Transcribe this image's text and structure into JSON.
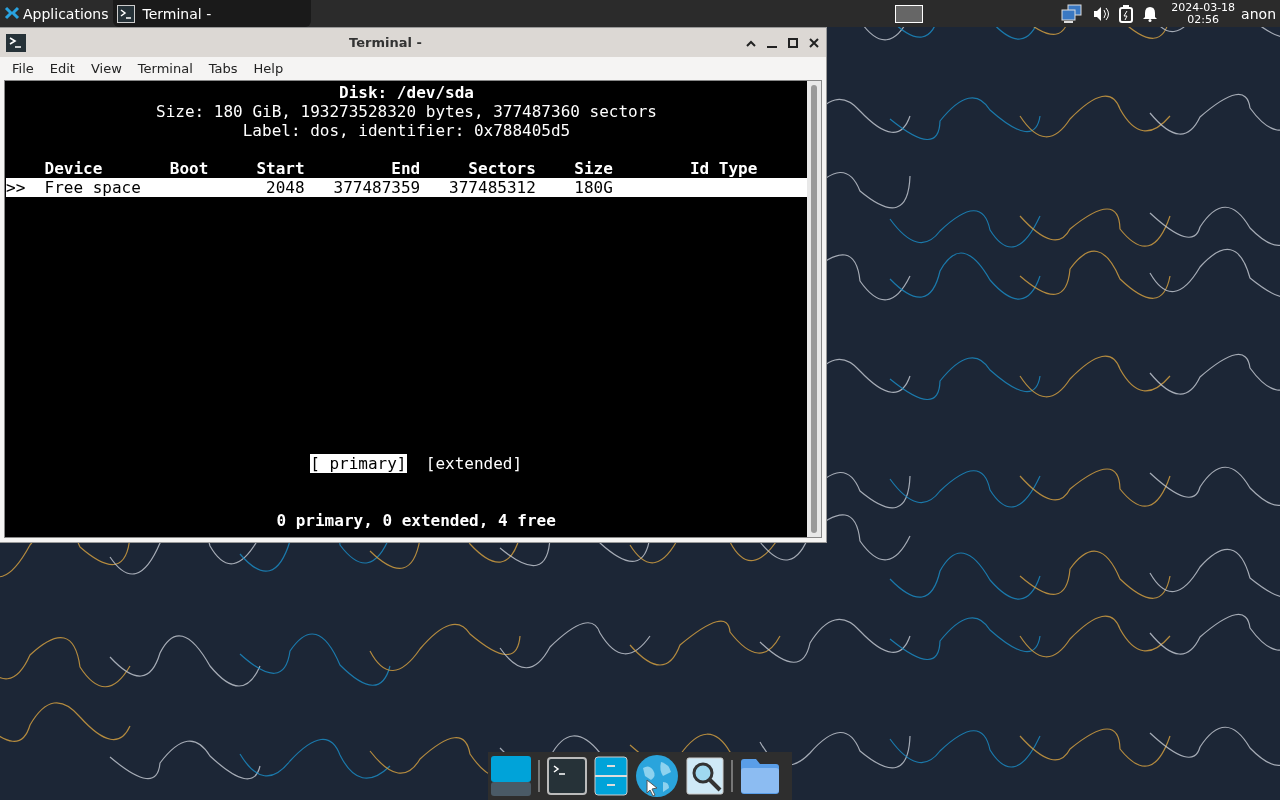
{
  "top_panel": {
    "menu_label": "Applications",
    "tasks": [
      {
        "title": "Terminal -",
        "selected": true
      }
    ],
    "clock": {
      "date": "2024-03-18",
      "time": "02:56"
    },
    "user": "anon"
  },
  "window": {
    "title": "Terminal -",
    "menu": [
      "File",
      "Edit",
      "View",
      "Terminal",
      "Tabs",
      "Help"
    ],
    "terminal": {
      "header": [
        {
          "text": "Disk: /dev/sda",
          "bold": true
        },
        {
          "text": "Size: 180 GiB, 193273528320 bytes, 377487360 sectors",
          "bold": false
        },
        {
          "text": "Label: dos, identifier: 0x788405d5",
          "bold": false
        }
      ],
      "columns": [
        "Device",
        "Boot",
        "Start",
        "End",
        "Sectors",
        "Size",
        "Id",
        "Type"
      ],
      "rows": [
        {
          "marker": ">>",
          "cells": [
            "Free space",
            "",
            "2048",
            "377487359",
            "377485312",
            "180G",
            "",
            ""
          ],
          "selected": true
        }
      ],
      "options": [
        {
          "label": "[ primary]",
          "selected": true
        },
        {
          "label": "[extended]",
          "selected": false
        }
      ],
      "status": "0 primary, 0 extended, 4 free"
    }
  }
}
